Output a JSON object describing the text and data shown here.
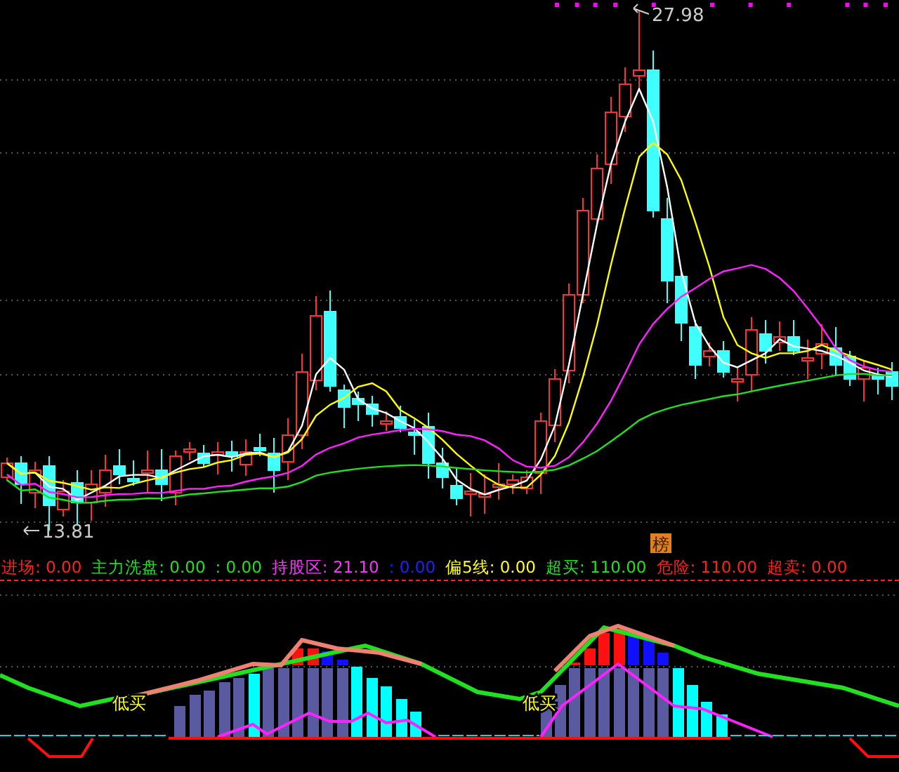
{
  "price_chart": {
    "high_label": "27.98",
    "low_label": "13.81",
    "tag": "榜"
  },
  "legend": [
    {
      "text": "进场: 0.00",
      "color": "#ff2020"
    },
    {
      "text": "主力洗盘: 0.00",
      "color": "#20e020"
    },
    {
      "text": ": 0.00",
      "color": "#20e020"
    },
    {
      "text": "持股区: 21.10",
      "color": "#ff30ff"
    },
    {
      "text": ": 0.00",
      "color": "#2020ff"
    },
    {
      "text": "偏5线: 0.00",
      "color": "#ffff20"
    },
    {
      "text": "超买: 110.00",
      "color": "#20e020"
    },
    {
      "text": "危险: 110.00",
      "color": "#ff2020"
    },
    {
      "text": "超卖: 0.00",
      "color": "#ff2020"
    }
  ],
  "indicator_chart": {
    "signals": [
      "低买",
      "低买"
    ]
  }
}
